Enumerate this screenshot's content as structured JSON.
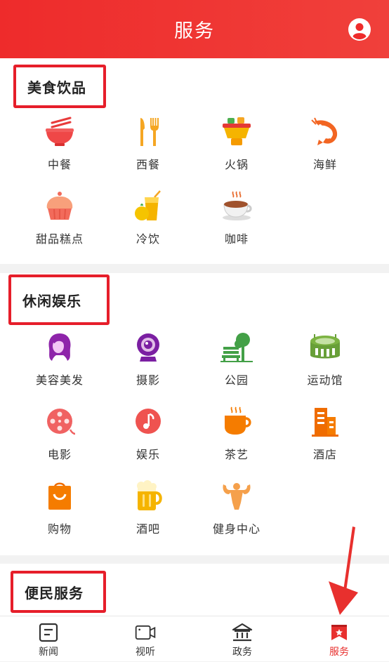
{
  "header": {
    "title": "服务",
    "user_icon": "user-circle-icon"
  },
  "sections": {
    "food": {
      "title": "美食饮品",
      "items": [
        {
          "label": "中餐",
          "icon": "noodle-bowl-icon"
        },
        {
          "label": "西餐",
          "icon": "fork-knife-icon"
        },
        {
          "label": "火锅",
          "icon": "hotpot-icon"
        },
        {
          "label": "海鲜",
          "icon": "shrimp-icon"
        },
        {
          "label": "甜品糕点",
          "icon": "cupcake-icon"
        },
        {
          "label": "冷饮",
          "icon": "juice-icon"
        },
        {
          "label": "咖啡",
          "icon": "coffee-cup-icon"
        }
      ]
    },
    "leisure": {
      "title": "休闲娱乐",
      "items": [
        {
          "label": "美容美发",
          "icon": "hair-salon-icon"
        },
        {
          "label": "摄影",
          "icon": "camera-icon"
        },
        {
          "label": "公园",
          "icon": "park-bench-icon"
        },
        {
          "label": "运动馆",
          "icon": "stadium-icon"
        },
        {
          "label": "电影",
          "icon": "film-reel-icon"
        },
        {
          "label": "娱乐",
          "icon": "music-note-icon"
        },
        {
          "label": "茶艺",
          "icon": "tea-cup-icon"
        },
        {
          "label": "酒店",
          "icon": "hotel-icon"
        },
        {
          "label": "购物",
          "icon": "shopping-bag-icon"
        },
        {
          "label": "酒吧",
          "icon": "beer-mug-icon"
        },
        {
          "label": "健身中心",
          "icon": "muscle-man-icon"
        }
      ]
    },
    "civic": {
      "title": "便民服务"
    }
  },
  "tabbar": {
    "tabs": [
      {
        "label": "新闻",
        "icon": "news-icon"
      },
      {
        "label": "视听",
        "icon": "video-icon"
      },
      {
        "label": "政务",
        "icon": "government-icon"
      },
      {
        "label": "服务",
        "icon": "service-flag-icon",
        "active": true
      }
    ]
  },
  "colors": {
    "brand": "#ee2b2b",
    "highlight": "#e61e2a",
    "active_tab": "#e8302e"
  }
}
